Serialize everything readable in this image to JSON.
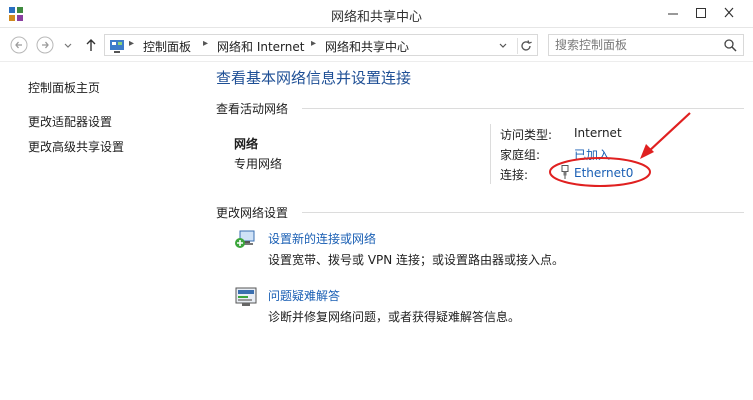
{
  "window": {
    "title": "网络和共享中心",
    "minimize_glyph": "—",
    "maximize_glyph": "□",
    "close_glyph": "✕"
  },
  "navbar": {
    "back_glyph": "←",
    "forward_glyph": "→",
    "dropdown_glyph": "▾",
    "up_glyph": "↑",
    "breadcrumbs": [
      "控制面板",
      "网络和 Internet",
      "网络和共享中心"
    ],
    "separator": "▸",
    "refresh_glyph": "↻",
    "search_placeholder": "搜索控制面板"
  },
  "sidebar": {
    "items": [
      "控制面板主页",
      "更改适配器设置",
      "更改高级共享设置"
    ]
  },
  "main": {
    "title": "查看基本网络信息并设置连接",
    "active_section": "查看活动网络",
    "network": {
      "name": "网络",
      "category": "专用网络",
      "access_type_label": "访问类型:",
      "access_type_value": "Internet",
      "homegroup_label": "家庭组:",
      "homegroup_value": "已加入",
      "connection_label": "连接:",
      "connection_value": "Ethernet0"
    },
    "change_section": "更改网络设置",
    "tasks": [
      {
        "link": "设置新的连接或网络",
        "desc": "设置宽带、拨号或 VPN 连接；或设置路由器或接入点。"
      },
      {
        "link": "问题疑难解答",
        "desc": "诊断并修复网络问题，或者获得疑难解答信息。"
      }
    ]
  },
  "icons": {
    "app": "network-center-icon",
    "search": "search-icon",
    "ethernet": "ethernet-icon",
    "new_connection": "new-connection-icon",
    "troubleshoot": "troubleshoot-icon"
  },
  "colors": {
    "title_blue": "#1e4f95",
    "link_blue": "#1a5fb4",
    "annotation_red": "#e02020"
  }
}
